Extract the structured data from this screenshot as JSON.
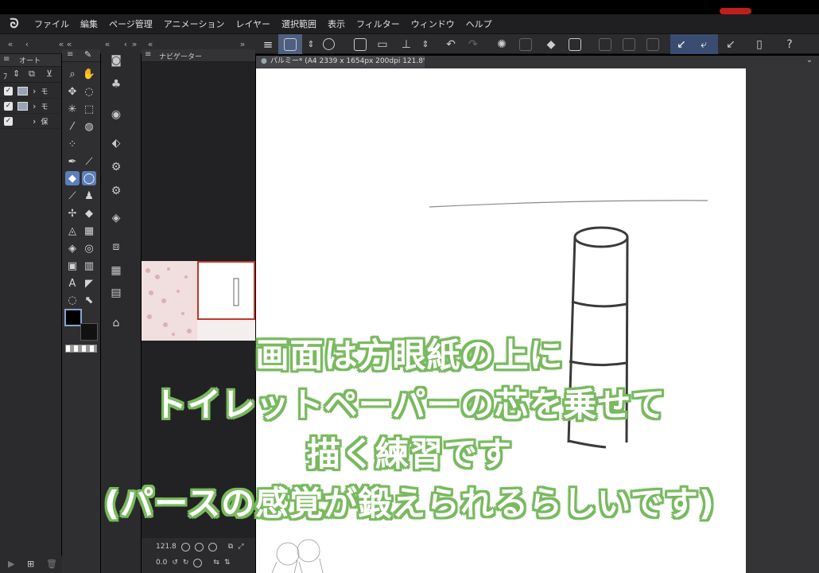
{
  "menu": {
    "items": [
      "ファイル",
      "編集",
      "ページ管理",
      "アニメーション",
      "レイヤー",
      "選択範囲",
      "表示",
      "フィルター",
      "ウィンドウ",
      "ヘルプ"
    ]
  },
  "layer_panel": {
    "header_label": "オート",
    "layers": [
      {
        "label": "モ",
        "checked": true,
        "has_thumb": true
      },
      {
        "label": "モ",
        "checked": true,
        "has_thumb": true
      },
      {
        "label": "保",
        "checked": true,
        "has_thumb": false
      }
    ]
  },
  "navigator": {
    "tab_label": "ナビゲーター",
    "zoom_value": "121.8",
    "rotation_value": "0.0"
  },
  "document": {
    "tab_label": "パルミー* (A4 2339 x 1654px 200dpi 121.8%)"
  },
  "caption": {
    "lines": [
      "画面は方眼紙の上に",
      "トイレットペーパーの芯を乗せて",
      "描く練習です",
      "(パースの感覚が鍛えられるらしいです)"
    ]
  },
  "colors": {
    "caption_outline": "#79b95f",
    "main_color": "#000000",
    "sub_color": "#111111",
    "accent_selected": "#5d7fb9",
    "nav_frame": "#c0392b"
  },
  "icons": {
    "tools": [
      "zoom-icon",
      "hand-icon",
      "move-icon",
      "lasso-icon",
      "magic-wand-icon",
      "object-icon",
      "eyedropper-icon",
      "chat-icon",
      "figure-icon",
      "pen-icon",
      "brush-icon",
      "marker-icon",
      "balloon-icon",
      "airbrush-icon",
      "stamp-icon",
      "blend-icon",
      "eraser-icon",
      "fill-icon",
      "grid-icon",
      "bucket-icon",
      "gradient-icon",
      "frame-icon",
      "text-icon",
      "ruler-icon",
      "balloon-tail-icon",
      "correction-icon"
    ]
  }
}
